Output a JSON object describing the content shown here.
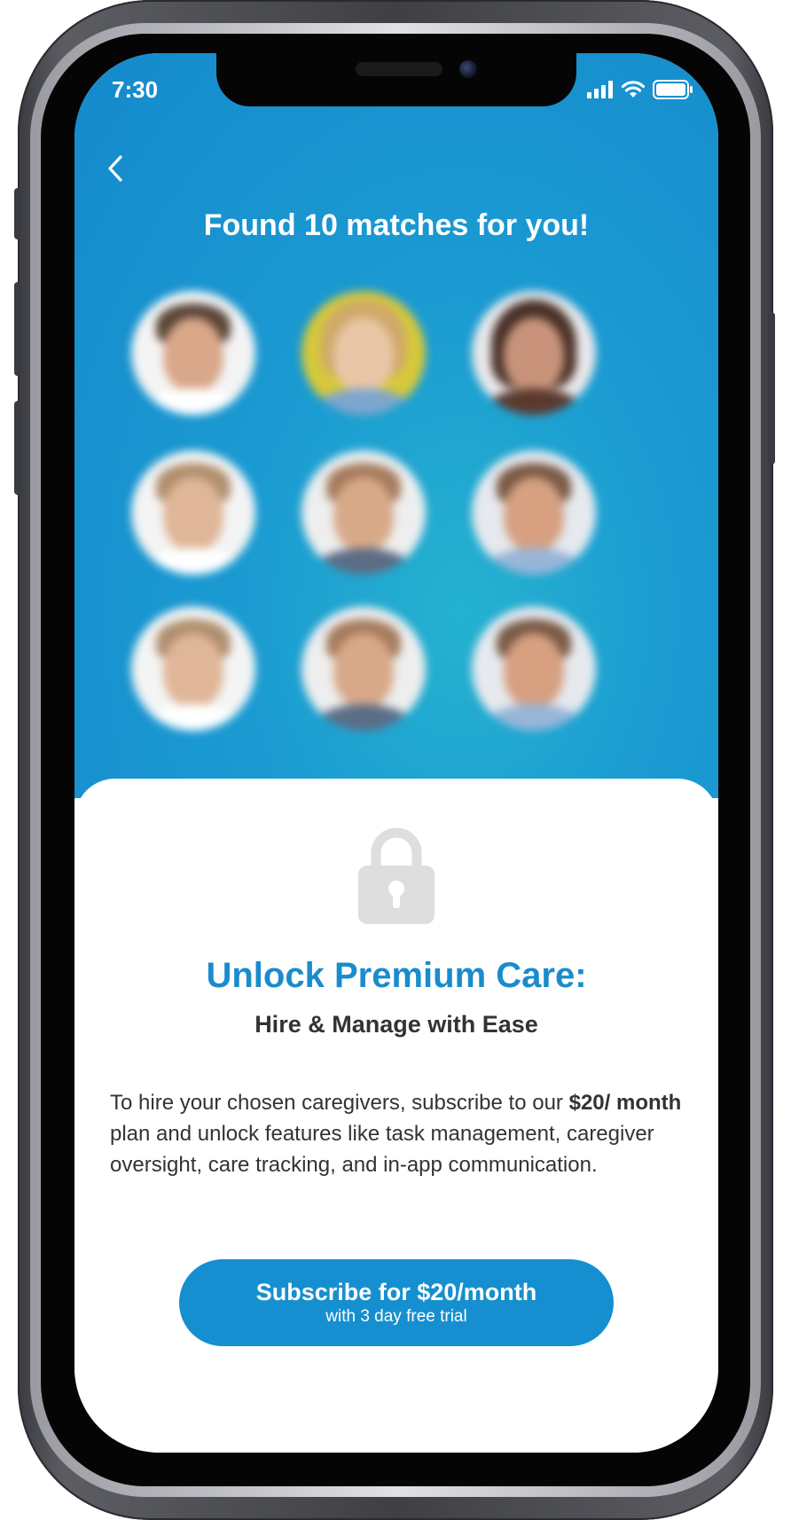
{
  "status_bar": {
    "time": "7:30",
    "icons": [
      "cellular-signal-icon",
      "wifi-icon",
      "battery-icon"
    ]
  },
  "header": {
    "back_icon": "chevron-left-icon",
    "title": "Found 10 matches for you!"
  },
  "matches": {
    "avatar_count_visible": 9,
    "blurred": true
  },
  "paywall": {
    "icon": "lock-icon",
    "title": "Unlock Premium Care:",
    "subtitle": "Hire & Manage with Ease",
    "body": {
      "text_1": "To hire your chosen caregivers, subscribe to our ",
      "price_bold": "$20/ month",
      "text_2": " plan and unlock features like task management, caregiver oversight, care tracking, and in-app communication."
    },
    "cta": {
      "label": "Subscribe for $20/month",
      "sublabel": "with 3 day free trial"
    }
  },
  "colors": {
    "hero_blue": "#1589cc",
    "hero_cyan": "#25b2d0",
    "accent": "#1a8ccc",
    "button": "#158fcf",
    "lock_gray": "#dedede",
    "text_dark": "#333333"
  }
}
